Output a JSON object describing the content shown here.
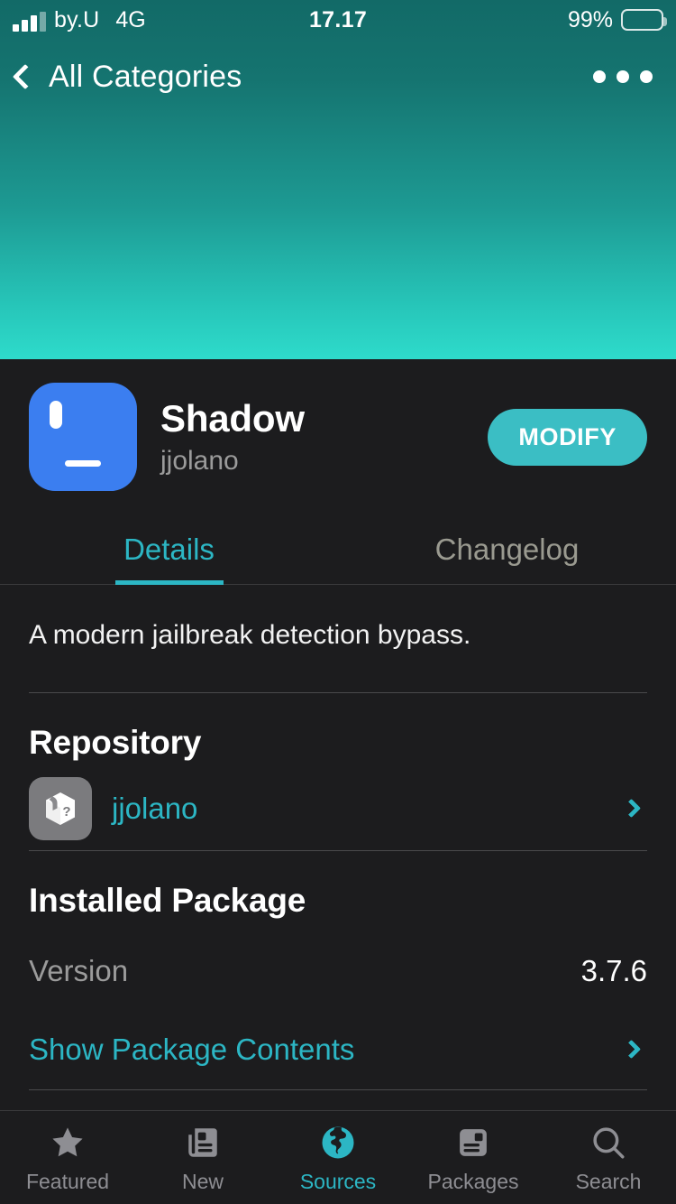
{
  "status_bar": {
    "carrier": "by.U",
    "network": "4G",
    "time": "17.17",
    "battery_percent": "99%",
    "signal_icon": "signal-bars-icon",
    "battery_icon": "battery-icon"
  },
  "navbar": {
    "back_label": "All Categories",
    "back_icon": "chevron-left-icon",
    "more_icon": "ellipsis-icon"
  },
  "package": {
    "name": "Shadow",
    "author": "jjolano",
    "action_label": "MODIFY",
    "icon": "monitor-icon",
    "icon_color": "#3b7ef0",
    "accent_color": "#3bbec4"
  },
  "tabs": [
    {
      "label": "Details",
      "active": true
    },
    {
      "label": "Changelog",
      "active": false
    }
  ],
  "details": {
    "description": "A modern jailbreak detection bypass.",
    "repository": {
      "heading": "Repository",
      "name": "jjolano",
      "icon": "package-question-icon",
      "chevron": "chevron-right-icon"
    },
    "installed": {
      "heading": "Installed Package",
      "version_key": "Version",
      "version_value": "3.7.6",
      "contents_label": "Show Package Contents",
      "chevron": "chevron-right-icon"
    }
  },
  "tabbar": {
    "items": [
      {
        "label": "Featured",
        "icon": "star-icon",
        "selected": false
      },
      {
        "label": "New",
        "icon": "newspaper-icon",
        "selected": false
      },
      {
        "label": "Sources",
        "icon": "globe-icon",
        "selected": true
      },
      {
        "label": "Packages",
        "icon": "package-label-icon",
        "selected": false
      },
      {
        "label": "Search",
        "icon": "magnifier-icon",
        "selected": false
      }
    ],
    "selected_color": "#2cb6c4",
    "inactive_color": "#8e8e93"
  }
}
